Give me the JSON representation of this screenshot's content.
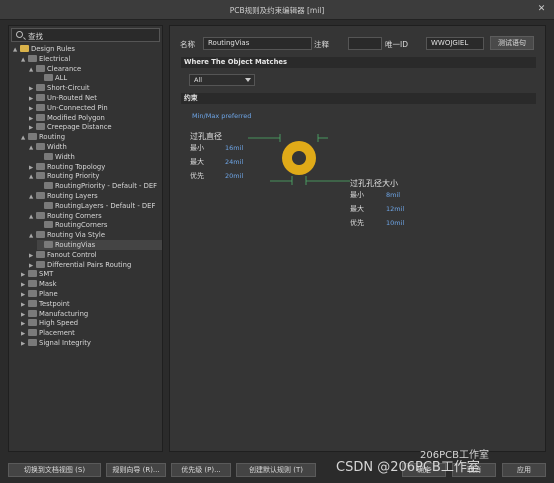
{
  "window": {
    "title": "PCB规则及约束编辑器 [mil]",
    "close": "✕"
  },
  "search": {
    "value": "查找"
  },
  "tree": {
    "items": [
      {
        "label": "Design Rules"
      },
      {
        "label": "Electrical"
      },
      {
        "label": "Clearance"
      },
      {
        "label": "ALL"
      },
      {
        "label": "Short-Circuit"
      },
      {
        "label": "Un-Routed Net"
      },
      {
        "label": "Un-Connected Pin"
      },
      {
        "label": "Modified Polygon"
      },
      {
        "label": "Creepage Distance"
      },
      {
        "label": "Routing"
      },
      {
        "label": "Width"
      },
      {
        "label": "Width"
      },
      {
        "label": "Routing Topology"
      },
      {
        "label": "Routing Priority"
      },
      {
        "label": "RoutingPriority - Default - DEF"
      },
      {
        "label": "Routing Layers"
      },
      {
        "label": "RoutingLayers - Default - DEF"
      },
      {
        "label": "Routing Corners"
      },
      {
        "label": "RoutingCorners"
      },
      {
        "label": "Routing Via Style"
      },
      {
        "label": "RoutingVias"
      },
      {
        "label": "Fanout Control"
      },
      {
        "label": "Differential Pairs Routing"
      },
      {
        "label": "SMT"
      },
      {
        "label": "Mask"
      },
      {
        "label": "Plane"
      },
      {
        "label": "Testpoint"
      },
      {
        "label": "Manufacturing"
      },
      {
        "label": "High Speed"
      },
      {
        "label": "Placement"
      },
      {
        "label": "Signal Integrity"
      }
    ]
  },
  "form": {
    "name_label": "名称",
    "name_value": "RoutingVias",
    "comment_label": "注释",
    "comment_value": "",
    "uid_label": "唯一ID",
    "uid_value": "WWOJGIEL",
    "test_button": "测试语句"
  },
  "match": {
    "header": "Where The Object Matches",
    "selected": "All"
  },
  "constraints": {
    "header": "约束",
    "preferred_label": "Min/Max preferred",
    "via_dia": {
      "title": "过孔直径",
      "min_label": "最小",
      "min": "16mil",
      "max_label": "最大",
      "max": "24mil",
      "pref_label": "优先",
      "pref": "20mil"
    },
    "hole": {
      "title": "过孔孔径大小",
      "min_label": "最小",
      "min": "8mil",
      "max_label": "最大",
      "max": "12mil",
      "pref_label": "优先",
      "pref": "10mil"
    }
  },
  "bottom": {
    "b1": "切换到文档视图 (S)",
    "b2": "规则向导 (R)...",
    "b3": "优先级 (P)...",
    "b4": "创建默认规则 (T)",
    "b5": "确定",
    "b6": "取消",
    "b7": "应用"
  },
  "watermark": {
    "a": "206PCB工作室",
    "b": "CSDN @206PCB工作室"
  }
}
